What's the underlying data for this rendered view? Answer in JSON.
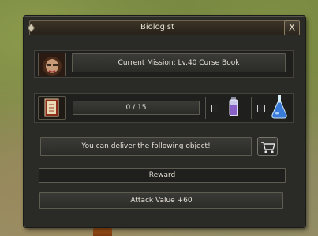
{
  "window": {
    "title": "Biologist",
    "close_label": "X"
  },
  "mission": {
    "text": "Current Mission: Lv.40 Curse Book",
    "portrait_icon": "npc-portrait-icon"
  },
  "progress": {
    "item_icon": "curse-book-icon",
    "count_text": "0 / 15",
    "current": 0,
    "total": 15,
    "potion_small_icon": "purple-potion-icon",
    "potion_large_icon": "blue-flask-icon"
  },
  "deliver": {
    "text": "You can deliver the following object!",
    "cart_icon": "shopping-cart-icon"
  },
  "reward": {
    "header": "Reward",
    "value": "Attack Value +60"
  }
}
